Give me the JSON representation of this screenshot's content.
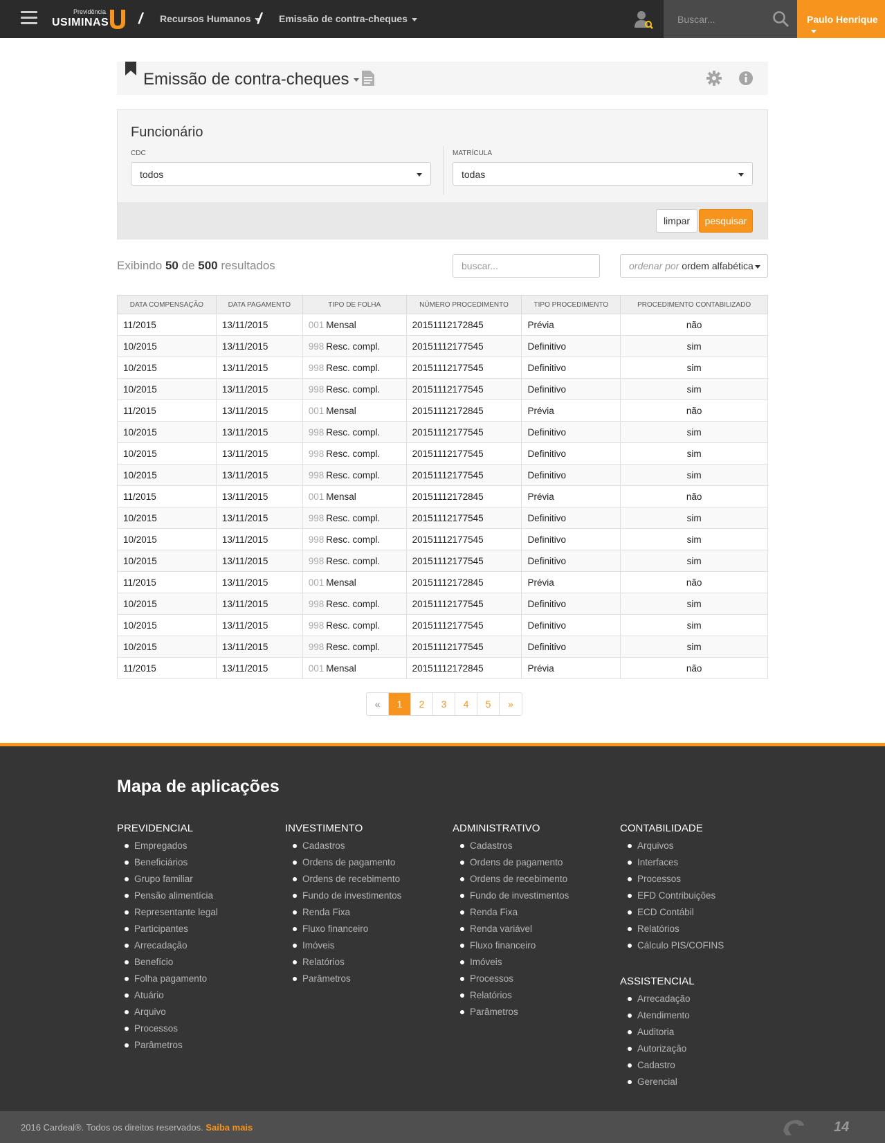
{
  "topbar": {
    "logo_small": "Previdência",
    "logo_big": "USIMINAS",
    "breadcrumbs": [
      {
        "label": "Recursos Humanos"
      },
      {
        "label": "Emissão de contra-cheques"
      }
    ],
    "search_placeholder": "Buscar...",
    "user_name": "Paulo Henrique"
  },
  "page": {
    "title": "Emissão de contra-cheques"
  },
  "filter": {
    "title": "Funcionário",
    "cdc_label": "CDC",
    "cdc_value": "todos",
    "matricula_label": "MATRÍCULA",
    "matricula_value": "todas",
    "clear_label": "limpar",
    "search_label": "pesquisar"
  },
  "results": {
    "prefix": "Exibindo",
    "shown": "50",
    "middle": "de",
    "total": "500",
    "suffix": "resultados",
    "search_placeholder": "buscar...",
    "order_label": "ordenar por",
    "order_value": "ordem alfabética"
  },
  "table": {
    "columns": [
      "DATA COMPENSAÇÃO",
      "DATA PAGAMENTO",
      "TIPO DE FOLHA",
      "NÚMERO PROCEDIMENTO",
      "TIPO PROCEDIMENTO",
      "PROCEDIMENTO CONTABILIZADO"
    ],
    "rows": [
      {
        "comp": "11/2015",
        "pag": "13/11/2015",
        "code": "001",
        "folha": "Mensal",
        "num": "20151112172845",
        "tipo": "Prévia",
        "contab": "não"
      },
      {
        "comp": "10/2015",
        "pag": "13/11/2015",
        "code": "998",
        "folha": "Resc. compl.",
        "num": "20151112177545",
        "tipo": "Definitivo",
        "contab": "sim"
      },
      {
        "comp": "10/2015",
        "pag": "13/11/2015",
        "code": "998",
        "folha": "Resc. compl.",
        "num": "20151112177545",
        "tipo": "Definitivo",
        "contab": "sim"
      },
      {
        "comp": "10/2015",
        "pag": "13/11/2015",
        "code": "998",
        "folha": "Resc. compl.",
        "num": "20151112177545",
        "tipo": "Definitivo",
        "contab": "sim"
      },
      {
        "comp": "11/2015",
        "pag": "13/11/2015",
        "code": "001",
        "folha": "Mensal",
        "num": "20151112172845",
        "tipo": "Prévia",
        "contab": "não"
      },
      {
        "comp": "10/2015",
        "pag": "13/11/2015",
        "code": "998",
        "folha": "Resc. compl.",
        "num": "20151112177545",
        "tipo": "Definitivo",
        "contab": "sim"
      },
      {
        "comp": "10/2015",
        "pag": "13/11/2015",
        "code": "998",
        "folha": "Resc. compl.",
        "num": "20151112177545",
        "tipo": "Definitivo",
        "contab": "sim"
      },
      {
        "comp": "10/2015",
        "pag": "13/11/2015",
        "code": "998",
        "folha": "Resc. compl.",
        "num": "20151112177545",
        "tipo": "Definitivo",
        "contab": "sim"
      },
      {
        "comp": "11/2015",
        "pag": "13/11/2015",
        "code": "001",
        "folha": "Mensal",
        "num": "20151112172845",
        "tipo": "Prévia",
        "contab": "não"
      },
      {
        "comp": "10/2015",
        "pag": "13/11/2015",
        "code": "998",
        "folha": "Resc. compl.",
        "num": "20151112177545",
        "tipo": "Definitivo",
        "contab": "sim"
      },
      {
        "comp": "10/2015",
        "pag": "13/11/2015",
        "code": "998",
        "folha": "Resc. compl.",
        "num": "20151112177545",
        "tipo": "Definitivo",
        "contab": "sim"
      },
      {
        "comp": "10/2015",
        "pag": "13/11/2015",
        "code": "998",
        "folha": "Resc. compl.",
        "num": "20151112177545",
        "tipo": "Definitivo",
        "contab": "sim"
      },
      {
        "comp": "11/2015",
        "pag": "13/11/2015",
        "code": "001",
        "folha": "Mensal",
        "num": "20151112172845",
        "tipo": "Prévia",
        "contab": "não"
      },
      {
        "comp": "10/2015",
        "pag": "13/11/2015",
        "code": "998",
        "folha": "Resc. compl.",
        "num": "20151112177545",
        "tipo": "Definitivo",
        "contab": "sim"
      },
      {
        "comp": "10/2015",
        "pag": "13/11/2015",
        "code": "998",
        "folha": "Resc. compl.",
        "num": "20151112177545",
        "tipo": "Definitivo",
        "contab": "sim"
      },
      {
        "comp": "10/2015",
        "pag": "13/11/2015",
        "code": "998",
        "folha": "Resc. compl.",
        "num": "20151112177545",
        "tipo": "Definitivo",
        "contab": "sim"
      },
      {
        "comp": "11/2015",
        "pag": "13/11/2015",
        "code": "001",
        "folha": "Mensal",
        "num": "20151112172845",
        "tipo": "Prévia",
        "contab": "não"
      }
    ]
  },
  "pagination": {
    "prev": "«",
    "pages": [
      "1",
      "2",
      "3",
      "4",
      "5"
    ],
    "active": "1",
    "next": "»"
  },
  "footer": {
    "map_title": "Mapa de aplicações",
    "columns": [
      {
        "title": "PREVIDENCIAL",
        "items": [
          "Empregados",
          "Beneficiários",
          "Grupo familiar",
          "Pensão alimentícia",
          "Representante legal",
          "Participantes",
          "Arrecadação",
          "Benefício",
          "Folha pagamento",
          "Atuário",
          "Arquivo",
          "Processos",
          "Parâmetros"
        ]
      },
      {
        "title": "INVESTIMENTO",
        "items": [
          "Cadastros",
          "Ordens de pagamento",
          "Ordens de recebimento",
          "Fundo de investimentos",
          "Renda Fixa",
          "Fluxo financeiro",
          "Imóveis",
          "Relatórios",
          "Parâmetros"
        ]
      },
      {
        "title": "ADMINISTRATIVO",
        "items": [
          "Cadastros",
          "Ordens de pagamento",
          "Ordens de recebimento",
          "Fundo de investimentos",
          "Renda Fixa",
          "Renda variável",
          "Fluxo financeiro",
          "Imóveis",
          "Processos",
          "Relatórios",
          "Parâmetros"
        ]
      },
      {
        "title": "CONTABILIDADE",
        "items": [
          "Arquivos",
          "Interfaces",
          "Processos",
          "EFD Contribuições",
          "ECD Contábil",
          "Relatórios",
          "Cálculo PIS/COFINS"
        ]
      },
      {
        "title": "ASSISTENCIAL",
        "items": [
          "Arrecadação",
          "Atendimento",
          "Auditoria",
          "Autorização",
          "Cadastro",
          "Gerencial"
        ]
      }
    ],
    "copyright": "2016 Cardeal®. Todos os direitos reservados.",
    "learn_more": "Saiba mais",
    "brand_mark": "14"
  },
  "colors": {
    "accent": "#f7941d",
    "topbar": "#2b2b2b",
    "footer": "#353535",
    "nao": "#b71c1c",
    "sim": "#2e7d32"
  }
}
